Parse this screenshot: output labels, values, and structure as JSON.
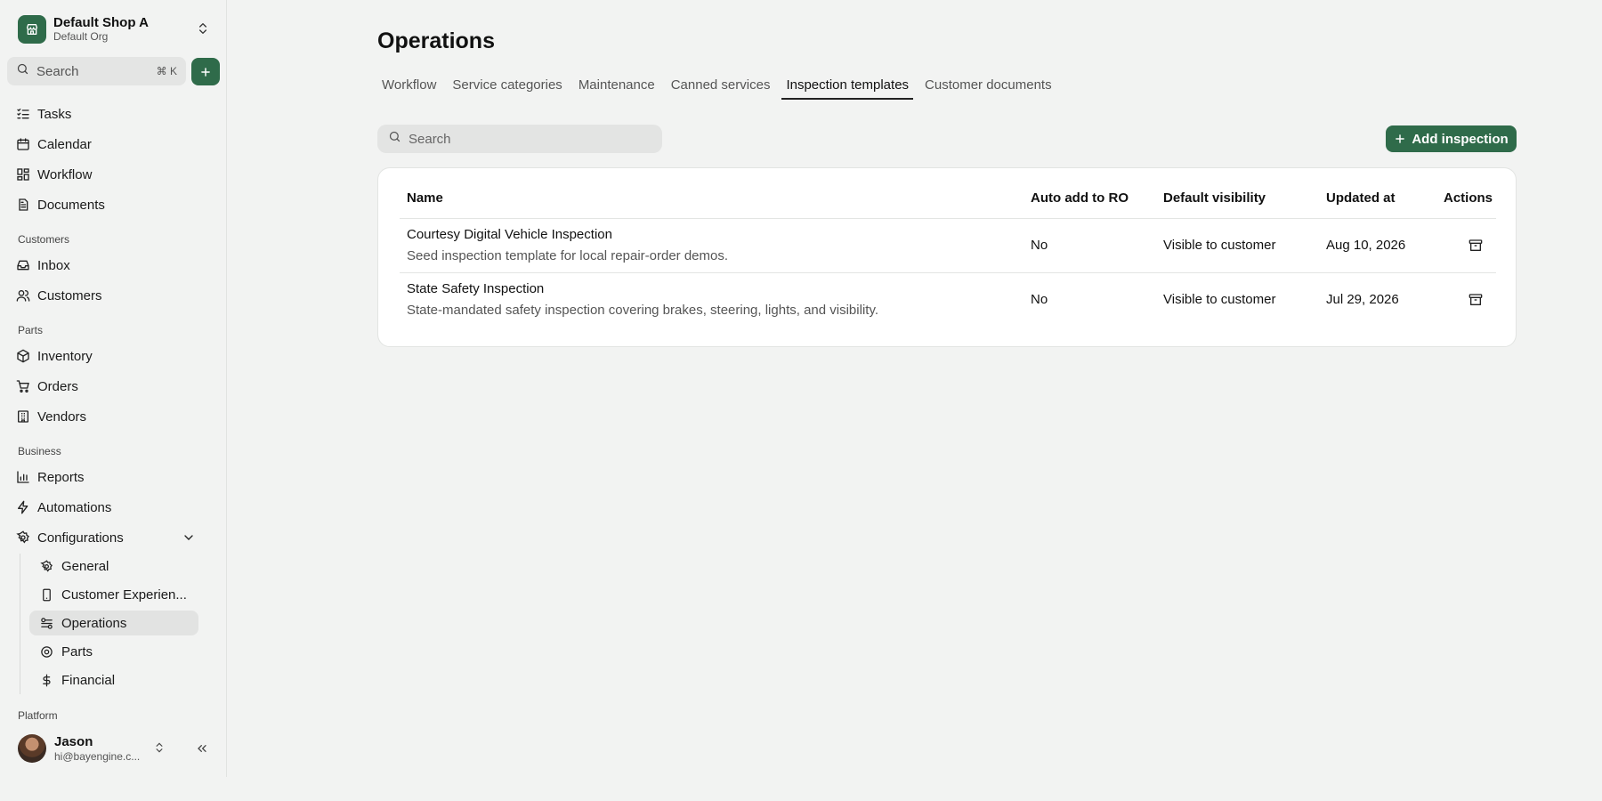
{
  "shop": {
    "name": "Default Shop A",
    "org": "Default Org"
  },
  "search": {
    "placeholder": "Search",
    "shortcut": "⌘ K"
  },
  "nav": {
    "primary": [
      {
        "label": "Tasks",
        "icon": "tasks-icon"
      },
      {
        "label": "Calendar",
        "icon": "calendar-icon"
      },
      {
        "label": "Workflow",
        "icon": "workflow-icon"
      },
      {
        "label": "Documents",
        "icon": "documents-icon"
      }
    ],
    "customers_label": "Customers",
    "customers": [
      {
        "label": "Inbox",
        "icon": "inbox-icon"
      },
      {
        "label": "Customers",
        "icon": "users-icon"
      }
    ],
    "parts_label": "Parts",
    "parts": [
      {
        "label": "Inventory",
        "icon": "package-icon"
      },
      {
        "label": "Orders",
        "icon": "cart-icon"
      },
      {
        "label": "Vendors",
        "icon": "building-icon"
      }
    ],
    "business_label": "Business",
    "business": [
      {
        "label": "Reports",
        "icon": "chart-icon"
      },
      {
        "label": "Automations",
        "icon": "bolt-icon"
      },
      {
        "label": "Configurations",
        "icon": "gear-icon"
      }
    ],
    "config_sub": [
      {
        "label": "General",
        "icon": "gear-icon"
      },
      {
        "label": "Customer Experien...",
        "icon": "phone-icon"
      },
      {
        "label": "Operations",
        "icon": "sliders-icon"
      },
      {
        "label": "Parts",
        "icon": "disc-icon"
      },
      {
        "label": "Financial",
        "icon": "dollar-icon"
      }
    ],
    "platform_label": "Platform"
  },
  "user": {
    "name": "Jason",
    "email": "hi@bayengine.c..."
  },
  "page": {
    "title": "Operations",
    "tabs": [
      "Workflow",
      "Service categories",
      "Maintenance",
      "Canned services",
      "Inspection templates",
      "Customer documents"
    ],
    "active_tab": "Inspection templates",
    "search_placeholder": "Search",
    "add_button": "Add inspection"
  },
  "table": {
    "columns": [
      "Name",
      "Auto add to RO",
      "Default visibility",
      "Updated at",
      "Actions"
    ],
    "rows": [
      {
        "name": "Courtesy Digital Vehicle Inspection",
        "description": "Seed inspection template for local repair-order demos.",
        "auto_add": "No",
        "visibility": "Visible to customer",
        "updated": "Aug 10, 2026"
      },
      {
        "name": "State Safety Inspection",
        "description": "State-mandated safety inspection covering brakes, steering, lights, and visibility.",
        "auto_add": "No",
        "visibility": "Visible to customer",
        "updated": "Jul 29, 2026"
      }
    ]
  },
  "colors": {
    "accent": "#2f6b4a",
    "background": "#f2f3f2"
  }
}
